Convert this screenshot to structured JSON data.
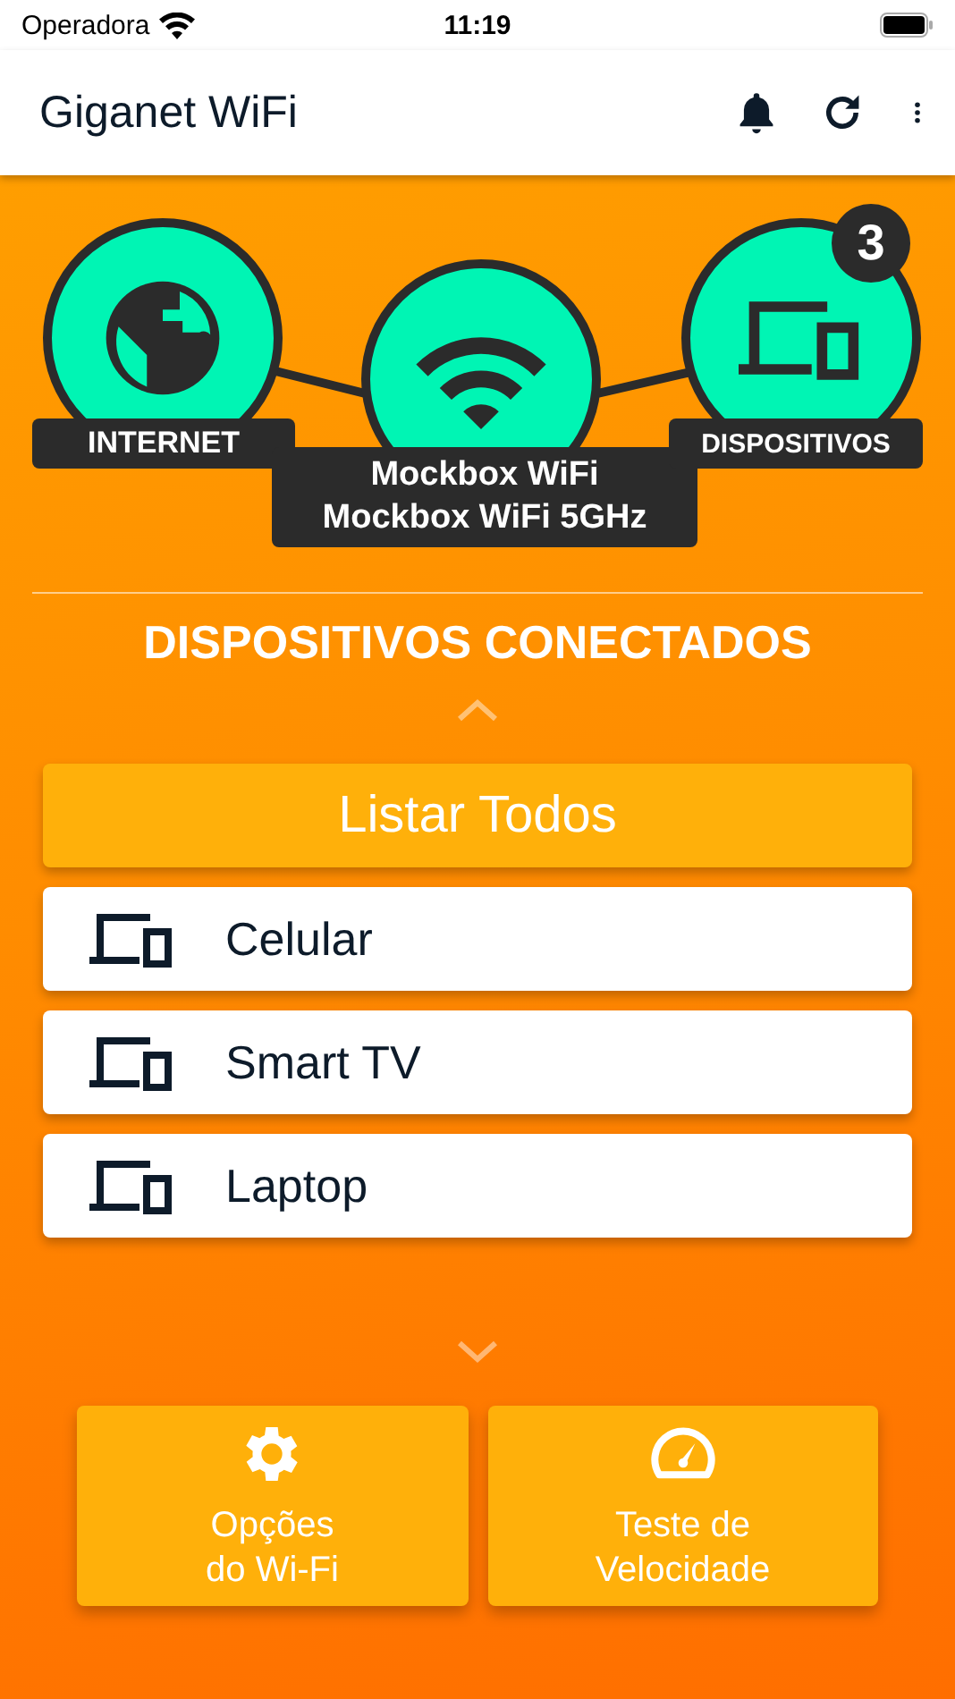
{
  "status_bar": {
    "carrier": "Operadora",
    "time": "11:19"
  },
  "app_bar": {
    "title": "Giganet WiFi"
  },
  "diagram": {
    "internet_label": "INTERNET",
    "networks": [
      "Mockbox WiFi",
      "Mockbox WiFi 5GHz"
    ],
    "devices_label": "DISPOSITIVOS",
    "device_count": "3"
  },
  "section_title": "DISPOSITIVOS CONECTADOS",
  "list_all_button": "Listar Todos",
  "devices": [
    {
      "name": "Celular"
    },
    {
      "name": "Smart TV"
    },
    {
      "name": "Laptop"
    }
  ],
  "actions": [
    {
      "kind": "settings",
      "label": "Opções\ndo Wi-Fi"
    },
    {
      "kind": "speed",
      "label": "Teste de\nVelocidade"
    }
  ]
}
